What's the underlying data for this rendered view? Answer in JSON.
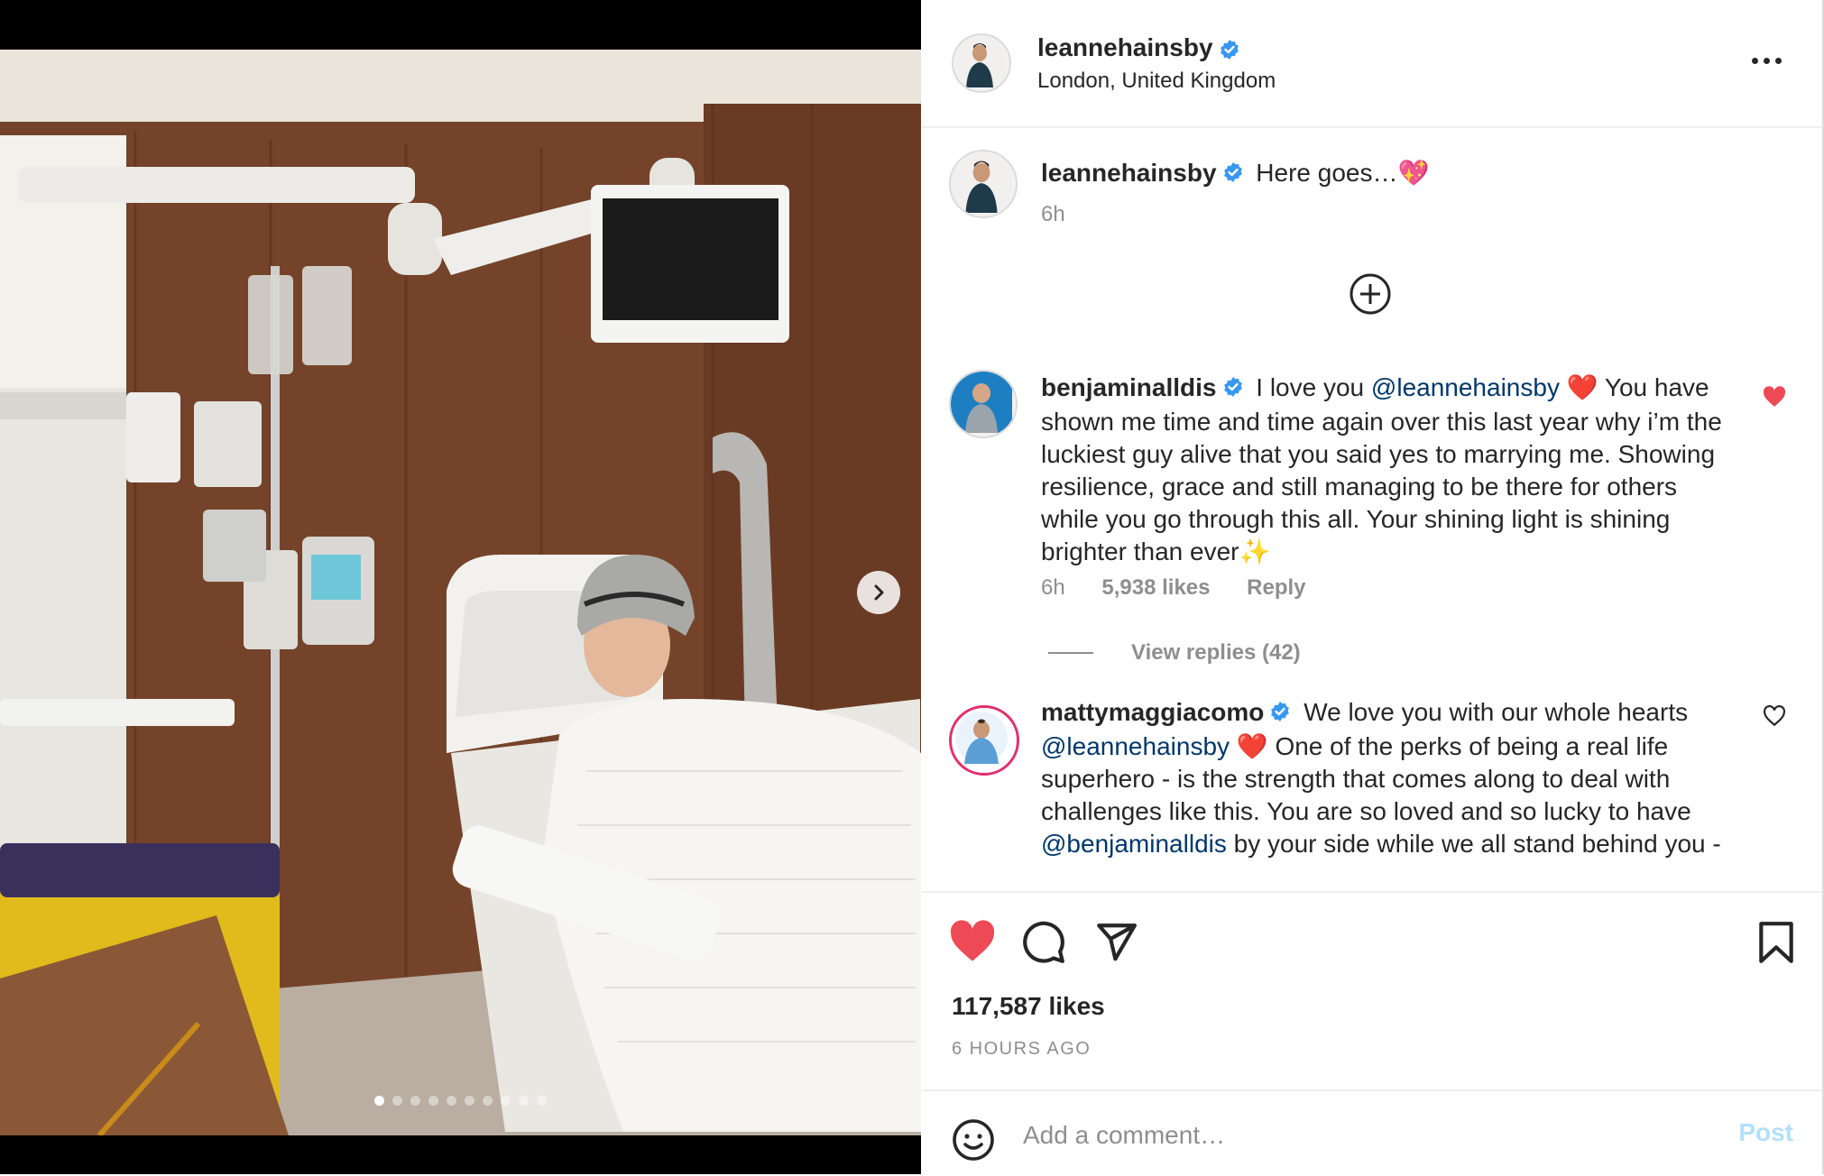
{
  "post": {
    "username": "leannehainsby",
    "location": "London, United Kingdom",
    "caption": {
      "username": "leannehainsby",
      "text": "Here goes…💖",
      "time": "6h"
    }
  },
  "media": {
    "carousel_count": 10,
    "active_index": 0,
    "next_icon": "chevron-right-icon"
  },
  "comments": [
    {
      "username": "benjaminalldis",
      "text_segments": [
        "I love you ",
        "@leannehainsby",
        " ❤️ You have shown me time and time again over this last year why i’m the luckiest guy alive that you said yes to marrying me. Showing resilience, grace and still managing to be there for others while you go through this all. Your shining light is shining brighter than ever✨"
      ],
      "time": "6h",
      "likes": "5,938 likes",
      "reply": "Reply",
      "liked": true,
      "view_replies": "View replies (42)"
    },
    {
      "username": "mattymaggiacomo",
      "text_segments": [
        "We love you with our whole hearts ",
        "@leannehainsby",
        " ❤️ One of the perks of being a real life superhero - is the strength that comes along to deal with challenges like this. You are so loved and so lucky to have ",
        "@benjaminalldis",
        " by your side while we all stand behind you -"
      ],
      "liked": false
    }
  ],
  "actions": {
    "likes": "117,587 likes",
    "time_ago": "6 HOURS AGO",
    "liked": true
  },
  "comment_box": {
    "placeholder": "Add a comment…",
    "post_label": "Post"
  },
  "colors": {
    "like_red": "#ed4956",
    "verified_blue": "#3897f0",
    "mention_blue": "#00376b",
    "post_disabled": "#b2dffc"
  }
}
